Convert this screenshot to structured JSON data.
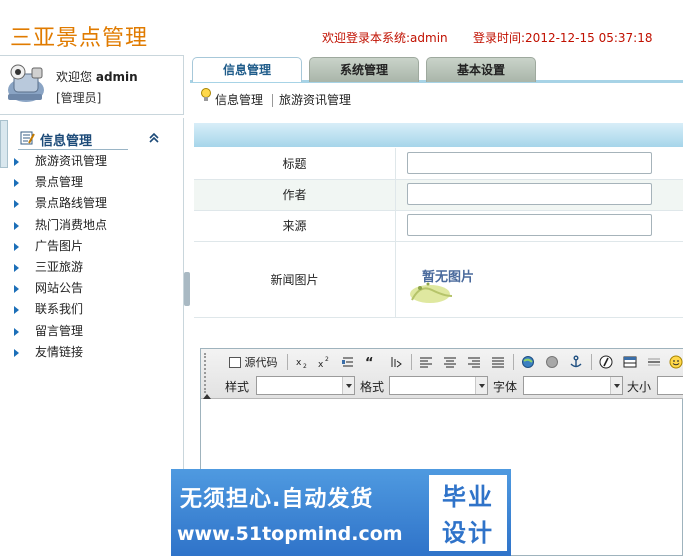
{
  "header": {
    "app_title": "三亚景点管理",
    "welcome_text": "欢迎登录本系统:admin",
    "login_time_text": "登录时间:2012-12-15 05:37:18"
  },
  "user": {
    "greeting": "欢迎您",
    "username": "admin",
    "role": "[管理员]"
  },
  "tabs": [
    {
      "label": "信息管理",
      "active": true
    },
    {
      "label": "系统管理",
      "active": false
    },
    {
      "label": "基本设置",
      "active": false
    }
  ],
  "breadcrumb": [
    "信息管理",
    "旅游资讯管理"
  ],
  "menu": {
    "heading": "信息管理",
    "items": [
      {
        "label": "旅游资讯管理"
      },
      {
        "label": "景点管理"
      },
      {
        "label": "景点路线管理"
      },
      {
        "label": "热门消费地点"
      },
      {
        "label": "广告图片"
      },
      {
        "label": "三亚旅游"
      },
      {
        "label": "网站公告"
      },
      {
        "label": "联系我们"
      },
      {
        "label": "留言管理"
      },
      {
        "label": "友情链接"
      }
    ]
  },
  "form": {
    "title_label": "标题",
    "title_value": "",
    "author_label": "作者",
    "author_value": "",
    "source_label": "来源",
    "source_value": "",
    "image_label": "新闻图片",
    "image_placeholder_text": "暂无图片"
  },
  "editor": {
    "source_button": "源代码",
    "style_label": "样式",
    "format_label": "格式",
    "font_label": "字体",
    "size_label": "大小"
  },
  "watermark": {
    "line1": "无须担心.自动发货",
    "line2": "www.51topmind.com",
    "badge_top": "毕业",
    "badge_bottom": "设计"
  },
  "colors": {
    "title_orange": "#e07b00",
    "header_red": "#c01000",
    "accent_blue": "#1c4a78",
    "form_header_blue": "#a6d5ea",
    "watermark_blue": "#2f73c9"
  }
}
